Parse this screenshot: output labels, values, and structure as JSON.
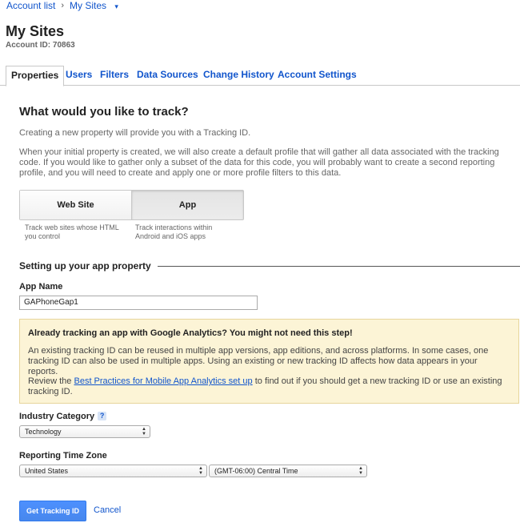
{
  "breadcrumb": {
    "account_list": "Account list",
    "separator": "›",
    "current": "My Sites",
    "caret": "▾"
  },
  "header": {
    "title": "My Sites",
    "account_id": "Account ID: 70863"
  },
  "tabs": [
    {
      "label": "Properties"
    },
    {
      "label": "Users"
    },
    {
      "label": "Filters"
    },
    {
      "label": "Data Sources"
    },
    {
      "label": "Change History"
    },
    {
      "label": "Account Settings"
    }
  ],
  "main": {
    "heading": "What would you like to track?",
    "intro": "Creating a new property will provide you with a Tracking ID.",
    "description": "When your initial property is created, we will also create a default profile that will gather all data associated with the tracking code. If you would like to gather only a subset of the data for this code, you will probably want to create a second reporting profile, and you will need to create and apply one or more profile filters to this data.",
    "track_options": [
      {
        "label": "Web Site",
        "desc": "Track web sites whose HTML you control"
      },
      {
        "label": "App",
        "desc": "Track interactions within Android and iOS apps"
      }
    ],
    "selected_option": "App"
  },
  "setup": {
    "section_title": "Setting up your app property",
    "app_name_label": "App Name",
    "app_name_value": "GAPhoneGap1"
  },
  "notice": {
    "title": "Already tracking an app with Google Analytics? You might not need this step!",
    "body": "An existing tracking ID can be reused in multiple app versions, app editions, and across platforms. In some cases, one tracking ID can also be used in multiple apps. Using an existing or new tracking ID affects how data appears in your reports.",
    "review_prefix": "Review the ",
    "link_text": "Best Practices for Mobile App Analytics set up",
    "review_suffix": " to find out if you should get a new tracking ID or use an existing tracking ID."
  },
  "industry": {
    "label": "Industry Category",
    "help": "?",
    "value": "Technology"
  },
  "timezone": {
    "label": "Reporting Time Zone",
    "country": "United States",
    "zone": "(GMT-06:00) Central Time"
  },
  "actions": {
    "primary": "Get Tracking ID",
    "cancel": "Cancel"
  },
  "colors": {
    "link": "#1155cc",
    "primary_button": "#4d90fe",
    "notice_bg": "#fcf4d6"
  },
  "icons": {
    "caret": "chevron-down-icon",
    "help": "help-icon",
    "select_arrows": "updown-arrows-icon"
  }
}
